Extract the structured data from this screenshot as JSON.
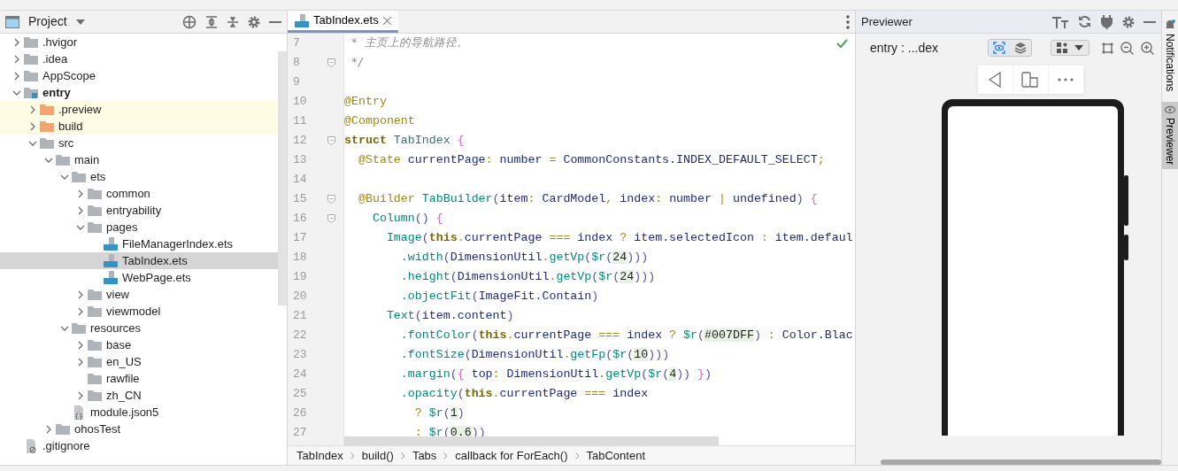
{
  "project_panel": {
    "title": "Project"
  },
  "tree": [
    {
      "label": ".hvigor",
      "kind": "folder",
      "expanded": false,
      "selected": false
    },
    {
      "label": ".idea",
      "kind": "folder",
      "expanded": false,
      "selected": false
    },
    {
      "label": "AppScope",
      "kind": "folder",
      "expanded": false,
      "selected": false
    },
    {
      "label": "entry",
      "kind": "module",
      "expanded": true,
      "selected": false,
      "children": [
        {
          "label": ".preview",
          "kind": "excluded",
          "expanded": false,
          "selected": false
        },
        {
          "label": "build",
          "kind": "excluded",
          "expanded": false,
          "selected": false
        },
        {
          "label": "src",
          "kind": "folder",
          "expanded": true,
          "selected": false,
          "children": [
            {
              "label": "main",
              "kind": "folder",
              "expanded": true,
              "selected": false,
              "children": [
                {
                  "label": "ets",
                  "kind": "folder",
                  "expanded": true,
                  "selected": false,
                  "children": [
                    {
                      "label": "common",
                      "kind": "folder",
                      "expanded": false,
                      "selected": false
                    },
                    {
                      "label": "entryability",
                      "kind": "folder",
                      "expanded": false,
                      "selected": false
                    },
                    {
                      "label": "pages",
                      "kind": "folder",
                      "expanded": true,
                      "selected": false,
                      "children": [
                        {
                          "label": "FileManagerIndex.ets",
                          "kind": "ets",
                          "selected": false
                        },
                        {
                          "label": "TabIndex.ets",
                          "kind": "ets",
                          "selected": true
                        },
                        {
                          "label": "WebPage.ets",
                          "kind": "ets",
                          "selected": false
                        }
                      ]
                    },
                    {
                      "label": "view",
                      "kind": "folder",
                      "expanded": false,
                      "selected": false
                    },
                    {
                      "label": "viewmodel",
                      "kind": "folder",
                      "expanded": false,
                      "selected": false
                    }
                  ]
                },
                {
                  "label": "resources",
                  "kind": "folder",
                  "expanded": true,
                  "selected": false,
                  "children": [
                    {
                      "label": "base",
                      "kind": "folder",
                      "expanded": false,
                      "selected": false
                    },
                    {
                      "label": "en_US",
                      "kind": "folder",
                      "expanded": false,
                      "selected": false
                    },
                    {
                      "label": "rawfile",
                      "kind": "folder",
                      "selected": false
                    },
                    {
                      "label": "zh_CN",
                      "kind": "folder",
                      "expanded": false,
                      "selected": false
                    }
                  ]
                },
                {
                  "label": "module.json5",
                  "kind": "json",
                  "selected": false
                }
              ]
            },
            {
              "label": "ohosTest",
              "kind": "folder",
              "expanded": false,
              "selected": false
            }
          ]
        }
      ]
    },
    {
      "label": ".gitignore",
      "kind": "file",
      "selected": false
    }
  ],
  "editor": {
    "tab": {
      "label": "TabIndex.ets",
      "selected": true
    },
    "lines": [
      {
        "number": "7",
        "fold": false,
        "tokens": [
          {
            "kind": "cm",
            "text": " * 主页上的导航路径。"
          }
        ]
      },
      {
        "number": "8",
        "fold": true,
        "tokens": [
          {
            "kind": "cm",
            "text": " */"
          }
        ]
      },
      {
        "number": "9",
        "fold": false
      },
      {
        "number": "10",
        "fold": false,
        "tokens": [
          {
            "kind": "an",
            "text": "@Entry"
          }
        ]
      },
      {
        "number": "11",
        "fold": false,
        "tokens": [
          {
            "kind": "an",
            "text": "@Component"
          }
        ]
      },
      {
        "number": "12",
        "fold": true,
        "tokens": [
          {
            "kind": "kw",
            "text": "struct "
          },
          {
            "kind": "ty",
            "text": "TabIndex "
          },
          {
            "kind": "br",
            "text": "{"
          }
        ]
      },
      {
        "number": "13",
        "fold": false,
        "tokens": [
          {
            "kind": "an",
            "text": "  @State "
          },
          {
            "kind": "id",
            "text": "currentPage"
          },
          {
            "kind": "an",
            "text": ": "
          },
          {
            "kind": "id",
            "text": "number "
          },
          {
            "kind": "an",
            "text": "= "
          },
          {
            "kind": "id",
            "text": "CommonConstants.INDEX_DEFAULT_SELECT"
          },
          {
            "kind": "an",
            "text": ";"
          }
        ]
      },
      {
        "number": "14",
        "fold": false
      },
      {
        "number": "15",
        "fold": true,
        "tokens": [
          {
            "kind": "an",
            "text": "  @Builder "
          },
          {
            "kind": "fn",
            "text": "TabBuilder"
          },
          {
            "kind": "p",
            "text": "("
          },
          {
            "kind": "id",
            "text": "item"
          },
          {
            "kind": "an",
            "text": ": "
          },
          {
            "kind": "id",
            "text": "CardModel"
          },
          {
            "kind": "an",
            "text": ", "
          },
          {
            "kind": "id",
            "text": "index"
          },
          {
            "kind": "an",
            "text": ": "
          },
          {
            "kind": "id",
            "text": "number "
          },
          {
            "kind": "an",
            "text": "| "
          },
          {
            "kind": "id",
            "text": "undefined"
          },
          {
            "kind": "p",
            "text": ") "
          },
          {
            "kind": "br",
            "text": "{"
          }
        ]
      },
      {
        "number": "16",
        "fold": true,
        "tokens": [
          {
            "kind": "fn",
            "text": "    Column"
          },
          {
            "kind": "p",
            "text": "() "
          },
          {
            "kind": "br",
            "text": "{"
          }
        ]
      },
      {
        "number": "17",
        "fold": false,
        "tokens": [
          {
            "kind": "fn",
            "text": "      Image"
          },
          {
            "kind": "p",
            "text": "("
          },
          {
            "kind": "kw",
            "text": "this"
          },
          {
            "kind": "an",
            "text": "."
          },
          {
            "kind": "id",
            "text": "currentPage "
          },
          {
            "kind": "an",
            "text": "=== "
          },
          {
            "kind": "id",
            "text": "index "
          },
          {
            "kind": "an",
            "text": "? "
          },
          {
            "kind": "id",
            "text": "item.selectedIcon "
          },
          {
            "kind": "an",
            "text": ": "
          },
          {
            "kind": "id",
            "text": "item.defaul"
          }
        ]
      },
      {
        "number": "18",
        "fold": false,
        "tokens": [
          {
            "kind": "fn",
            "text": "        .width"
          },
          {
            "kind": "p",
            "text": "("
          },
          {
            "kind": "id",
            "text": "DimensionUtil"
          },
          {
            "kind": "an",
            "text": "."
          },
          {
            "kind": "fn",
            "text": "getVp"
          },
          {
            "kind": "p",
            "text": "("
          },
          {
            "kind": "fn",
            "text": "$r"
          },
          {
            "kind": "p",
            "text": "("
          },
          {
            "kind": "num",
            "text": "24"
          },
          {
            "kind": "p",
            "text": ")))"
          }
        ]
      },
      {
        "number": "19",
        "fold": false,
        "tokens": [
          {
            "kind": "fn",
            "text": "        .height"
          },
          {
            "kind": "p",
            "text": "("
          },
          {
            "kind": "id",
            "text": "DimensionUtil"
          },
          {
            "kind": "an",
            "text": "."
          },
          {
            "kind": "fn",
            "text": "getVp"
          },
          {
            "kind": "p",
            "text": "("
          },
          {
            "kind": "fn",
            "text": "$r"
          },
          {
            "kind": "p",
            "text": "("
          },
          {
            "kind": "num",
            "text": "24"
          },
          {
            "kind": "p",
            "text": ")))"
          }
        ]
      },
      {
        "number": "20",
        "fold": false,
        "tokens": [
          {
            "kind": "fn",
            "text": "        .objectFit"
          },
          {
            "kind": "p",
            "text": "("
          },
          {
            "kind": "id",
            "text": "ImageFit.Contain"
          },
          {
            "kind": "p",
            "text": ")"
          }
        ]
      },
      {
        "number": "21",
        "fold": false,
        "tokens": [
          {
            "kind": "fn",
            "text": "      Text"
          },
          {
            "kind": "p",
            "text": "("
          },
          {
            "kind": "id",
            "text": "item.content"
          },
          {
            "kind": "p",
            "text": ")"
          }
        ]
      },
      {
        "number": "22",
        "fold": false,
        "tokens": [
          {
            "kind": "fn",
            "text": "        .fontColor"
          },
          {
            "kind": "p",
            "text": "("
          },
          {
            "kind": "kw",
            "text": "this"
          },
          {
            "kind": "an",
            "text": "."
          },
          {
            "kind": "id",
            "text": "currentPage "
          },
          {
            "kind": "an",
            "text": "=== "
          },
          {
            "kind": "id",
            "text": "index "
          },
          {
            "kind": "an",
            "text": "? "
          },
          {
            "kind": "fn",
            "text": "$r"
          },
          {
            "kind": "p",
            "text": "("
          },
          {
            "kind": "num",
            "text": "#007DFF"
          },
          {
            "kind": "p",
            "text": ") "
          },
          {
            "kind": "an",
            "text": ": "
          },
          {
            "kind": "id",
            "text": "Color.Blac"
          }
        ]
      },
      {
        "number": "23",
        "fold": false,
        "tokens": [
          {
            "kind": "fn",
            "text": "        .fontSize"
          },
          {
            "kind": "p",
            "text": "("
          },
          {
            "kind": "id",
            "text": "DimensionUtil"
          },
          {
            "kind": "an",
            "text": "."
          },
          {
            "kind": "fn",
            "text": "getFp"
          },
          {
            "kind": "p",
            "text": "("
          },
          {
            "kind": "fn",
            "text": "$r"
          },
          {
            "kind": "p",
            "text": "("
          },
          {
            "kind": "num",
            "text": "10"
          },
          {
            "kind": "p",
            "text": ")))"
          }
        ]
      },
      {
        "number": "24",
        "fold": false,
        "tokens": [
          {
            "kind": "fn",
            "text": "        .margin"
          },
          {
            "kind": "p",
            "text": "("
          },
          {
            "kind": "br",
            "text": "{ "
          },
          {
            "kind": "id",
            "text": "top"
          },
          {
            "kind": "an",
            "text": ": "
          },
          {
            "kind": "id",
            "text": "DimensionUtil"
          },
          {
            "kind": "an",
            "text": "."
          },
          {
            "kind": "fn",
            "text": "getVp"
          },
          {
            "kind": "p",
            "text": "("
          },
          {
            "kind": "fn",
            "text": "$r"
          },
          {
            "kind": "p",
            "text": "("
          },
          {
            "kind": "num",
            "text": "4"
          },
          {
            "kind": "p",
            "text": ")) "
          },
          {
            "kind": "br",
            "text": "}"
          },
          {
            "kind": "p",
            "text": ")"
          }
        ]
      },
      {
        "number": "25",
        "fold": false,
        "tokens": [
          {
            "kind": "fn",
            "text": "        .opacity"
          },
          {
            "kind": "p",
            "text": "("
          },
          {
            "kind": "kw",
            "text": "this"
          },
          {
            "kind": "an",
            "text": "."
          },
          {
            "kind": "id",
            "text": "currentPage "
          },
          {
            "kind": "an",
            "text": "=== "
          },
          {
            "kind": "id",
            "text": "index"
          }
        ]
      },
      {
        "number": "26",
        "fold": false,
        "tokens": [
          {
            "kind": "an",
            "text": "          ? "
          },
          {
            "kind": "fn",
            "text": "$r"
          },
          {
            "kind": "p",
            "text": "("
          },
          {
            "kind": "num",
            "text": "1"
          },
          {
            "kind": "p",
            "text": ")"
          }
        ]
      },
      {
        "number": "27",
        "fold": false,
        "tokens": [
          {
            "kind": "an",
            "text": "          : "
          },
          {
            "kind": "fn",
            "text": "$r"
          },
          {
            "kind": "p",
            "text": "("
          },
          {
            "kind": "num",
            "text": "0.6"
          },
          {
            "kind": "p",
            "text": "))"
          }
        ]
      }
    ],
    "breadcrumbs": [
      "TabIndex",
      "build()",
      "Tabs",
      "callback for ForEach()",
      "TabContent"
    ]
  },
  "previewer": {
    "title": "Previewer",
    "target": "entry : ...dex",
    "view_modes": [
      {
        "selected": true
      },
      {
        "selected": false
      }
    ]
  },
  "side_tabs": [
    {
      "label": "Notifications",
      "selected": false
    },
    {
      "label": "Previewer",
      "selected": true
    }
  ]
}
